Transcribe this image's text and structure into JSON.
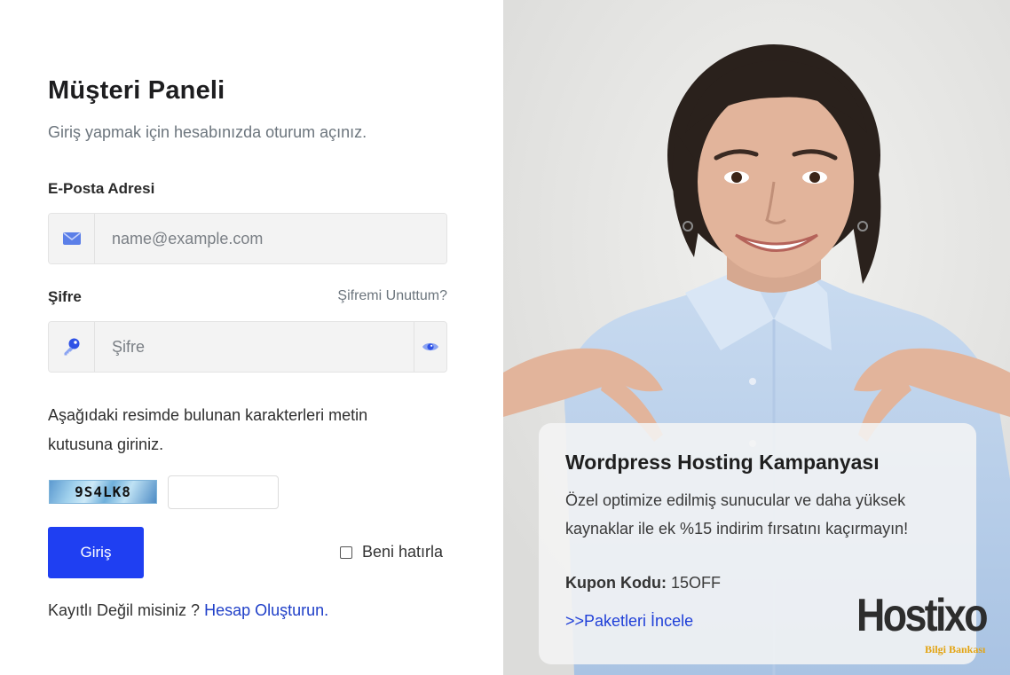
{
  "login": {
    "title": "Müşteri Paneli",
    "subtitle": "Giriş yapmak için hesabınızda oturum açınız.",
    "email_label": "E-Posta Adresi",
    "email_placeholder": "name@example.com",
    "password_label": "Şifre",
    "forgot_link": "Şifremi Unuttum?",
    "password_placeholder": "Şifre",
    "captcha_instructions": "Aşağıdaki resimde bulunan karakterleri metin kutusuna giriniz.",
    "captcha_code": "9S4LK8",
    "captcha_value": "",
    "login_button": "Giriş",
    "remember_label": "Beni hatırla",
    "remember_checked": false,
    "register_prompt": "Kayıtlı Değil misiniz ?",
    "register_link": "Hesap Oluşturun."
  },
  "promo": {
    "title": "Wordpress Hosting Kampanyası",
    "description": "Özel optimize edilmiş sunucular ve daha yüksek kaynaklar ile ek %15 indirim fırsatını kaçırmayın!",
    "coupon_label": "Kupon Kodu:",
    "coupon_code": "15OFF",
    "link": ">>Paketleri İncele"
  },
  "brand": {
    "logo_text": "Hostixo",
    "logo_subtitle": "Bilgi Bankası",
    "accent_color": "#1f3ff2",
    "logo_accent_color": "#e3a412"
  },
  "icons": {
    "email": "envelope-icon",
    "password": "key-icon",
    "visibility": "eye-icon"
  }
}
